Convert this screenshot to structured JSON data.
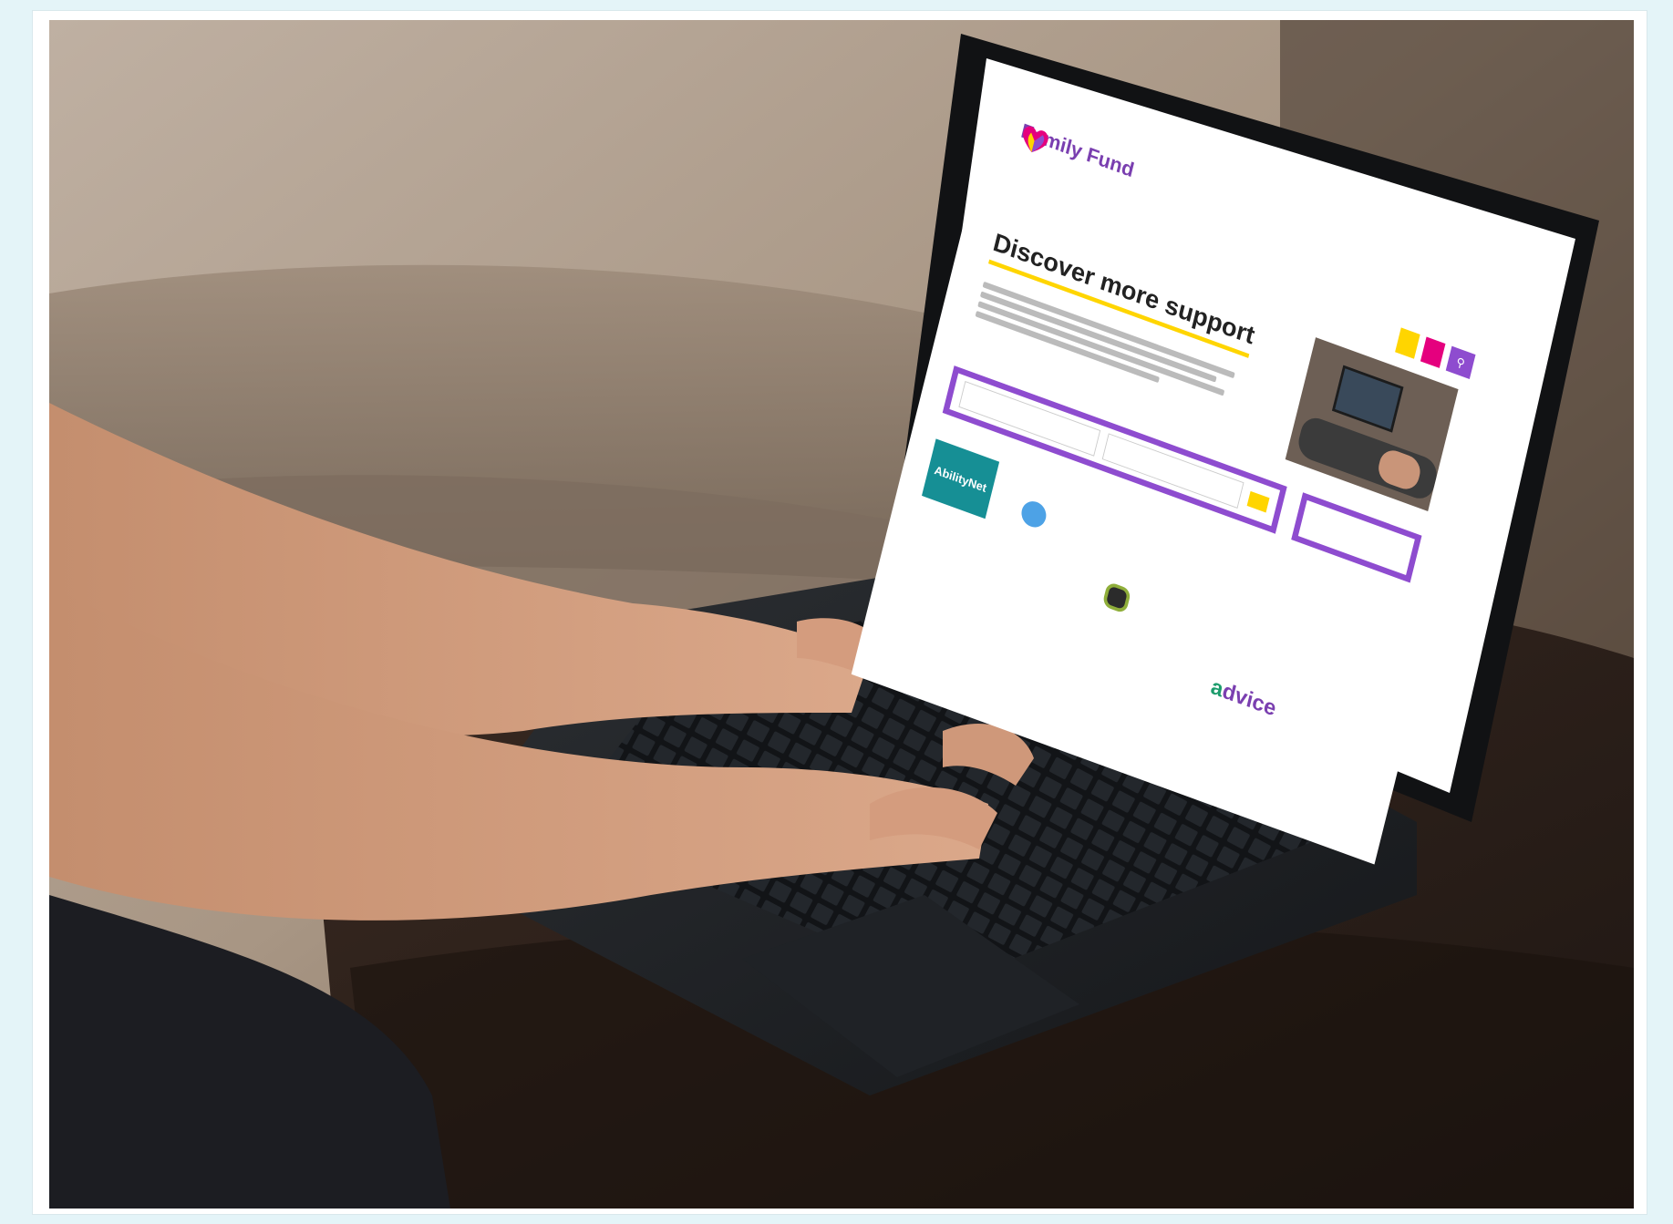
{
  "photo": {
    "description_alt": ""
  },
  "screen": {
    "logo_title": "Family Fund",
    "logo_tagline": "",
    "nav_items": [
      "",
      "",
      "",
      "",
      ""
    ],
    "heading": "Discover more support",
    "filter_label": "",
    "filter_button": "",
    "search_placeholder": "",
    "apply_button": "",
    "donate_button": "",
    "org_logos": [
      "AbilityNet",
      "dvice"
    ]
  },
  "colors": {
    "brand_purple": "#8e4ccf",
    "brand_pink": "#e5007e",
    "brand_yellow": "#ffd500",
    "frame_background": "#e4f4f8"
  }
}
